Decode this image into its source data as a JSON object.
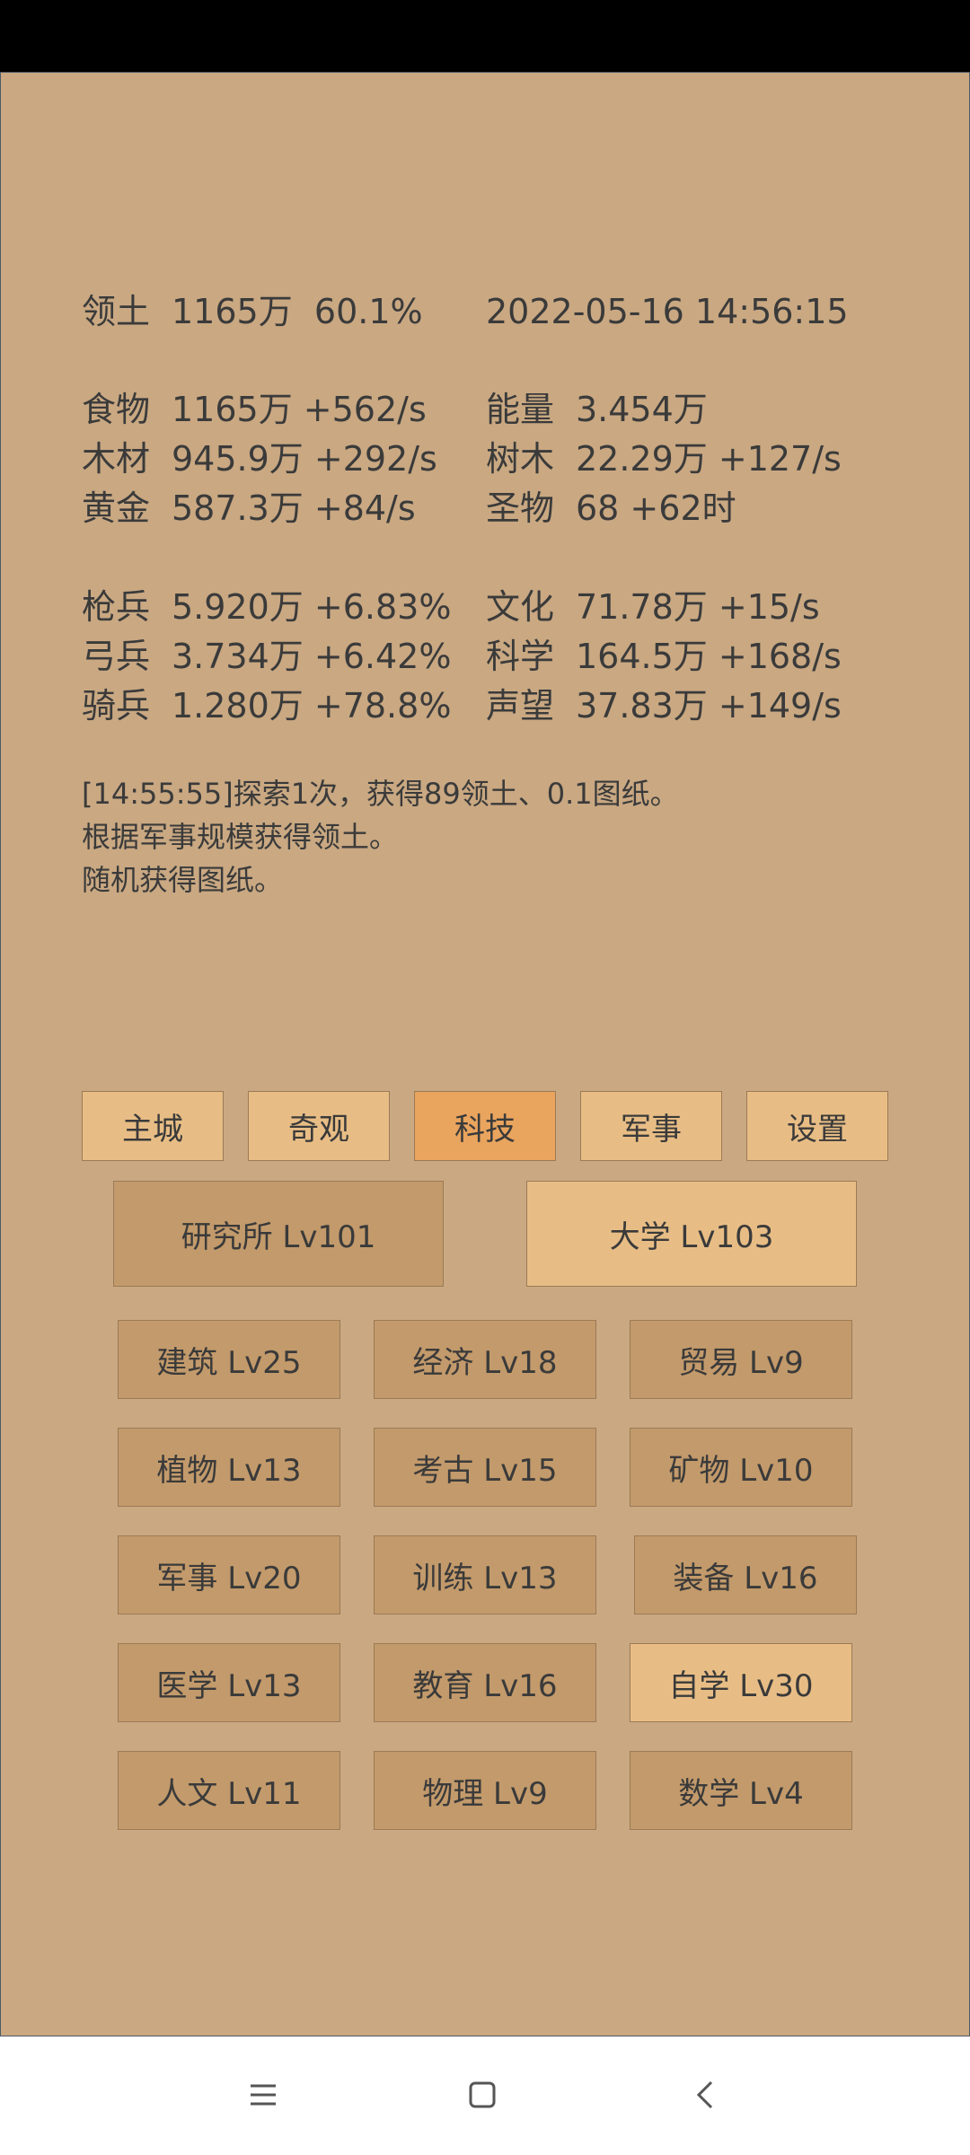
{
  "header": {
    "territory_label": "领土",
    "territory_value": "1165万",
    "territory_percent": "60.1%",
    "datetime": "2022-05-16 14:56:15"
  },
  "resources": [
    {
      "label": "食物",
      "value": "1165万 +562/s"
    },
    {
      "label": "能量",
      "value": "3.454万"
    },
    {
      "label": "木材",
      "value": "945.9万 +292/s"
    },
    {
      "label": "树木",
      "value": "22.29万 +127/s"
    },
    {
      "label": "黄金",
      "value": "587.3万 +84/s"
    },
    {
      "label": "圣物",
      "value": "68 +62时"
    }
  ],
  "units": [
    {
      "label": "枪兵",
      "value": "5.920万 +6.83%"
    },
    {
      "label": "文化",
      "value": "71.78万 +15/s"
    },
    {
      "label": "弓兵",
      "value": "3.734万 +6.42%"
    },
    {
      "label": "科学",
      "value": "164.5万 +168/s"
    },
    {
      "label": "骑兵",
      "value": "1.280万 +78.8%"
    },
    {
      "label": "声望",
      "value": "37.83万 +149/s"
    }
  ],
  "log": [
    "[14:55:55]探索1次，获得89领土、0.1图纸。",
    "根据军事规模获得领土。",
    "随机获得图纸。"
  ],
  "tabs": [
    "主城",
    "奇观",
    "科技",
    "军事",
    "设置"
  ],
  "active_tab": "科技",
  "buildings": [
    "研究所 Lv101",
    "大学 Lv103"
  ],
  "techs": [
    "建筑 Lv25",
    "经济 Lv18",
    "贸易 Lv9",
    "植物 Lv13",
    "考古 Lv15",
    "矿物 Lv10",
    "军事 Lv20",
    "训练 Lv13",
    "装备 Lv16",
    "医学 Lv13",
    "教育 Lv16",
    "自学 Lv30",
    "人文 Lv11",
    "物理 Lv9",
    "数学 Lv4"
  ],
  "colors": {
    "panel_bg": "#c9a882",
    "button_dark": "#c39a6b",
    "button_light": "#e8bd85",
    "button_active": "#e9a45e"
  },
  "nav_icons": [
    "menu-icon",
    "home-square-icon",
    "back-chevron-icon"
  ]
}
